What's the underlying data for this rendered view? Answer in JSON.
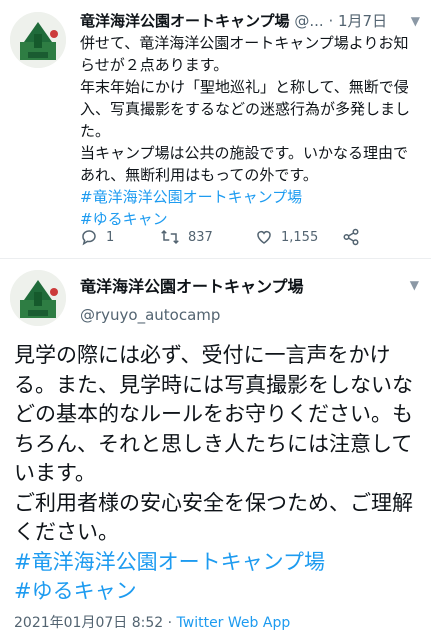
{
  "tweet1": {
    "display_name": "竜洋海洋公園オートキャンプ場",
    "handle": "@...",
    "dot": "·",
    "date": "1月7日",
    "lines": [
      "併せて、竜洋海洋公園オートキャンプ場よりお知らせが２点あります。",
      "年末年始にかけ「聖地巡礼」と称して、無断で侵入、写真撮影をするなどの迷惑行為が多発しました。",
      "当キャンプ場は公共の施設です。いかなる理由であれ、無断利用はもっての外です。"
    ],
    "hashtags": [
      "#竜洋海洋公園オートキャンプ場",
      "#ゆるキャン"
    ],
    "actions": {
      "reply_count": "1",
      "retweet_count": "837",
      "like_count": "1,155"
    },
    "icons": {
      "reply": "reply-icon",
      "retweet": "retweet-icon",
      "like": "heart-icon",
      "share": "share-icon",
      "menu": "chevron-down-icon"
    }
  },
  "tweet2": {
    "display_name": "竜洋海洋公園オートキャンプ場",
    "handle": "@ryuyo_autocamp",
    "lines": [
      "見学の際には必ず、受付に一言声をかける。また、見学時には写真撮影をしないなどの基本的なルールをお守りください。もちろん、それと思しき人たちには注意しています。",
      "ご利用者様の安心安全を保つため、ご理解ください。"
    ],
    "hashtags": [
      "#竜洋海洋公園オートキャンプ場",
      "#ゆるキャン"
    ],
    "timestamp": "2021年01月07日 8:52",
    "separator": "·",
    "source": "Twitter Web App"
  },
  "colors": {
    "accent": "#1d9bf0",
    "text": "#0f1419",
    "muted": "#536471",
    "avatar_green": "#1f6b3a"
  }
}
